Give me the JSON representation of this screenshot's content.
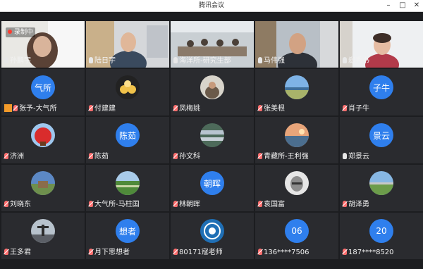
{
  "window": {
    "title": "腾讯会议"
  },
  "recording": {
    "label": "录制中"
  },
  "participants": [
    {
      "name": "孙鹏宇",
      "video": true
    },
    {
      "name": "陆日宇",
      "video": true
    },
    {
      "name": "海洋所-研究生部",
      "video": true
    },
    {
      "name": "马伟强",
      "video": true
    },
    {
      "name": "郄秀书",
      "video": true
    },
    {
      "name": "张予-大气所",
      "avatar_text": "气所",
      "host": true
    },
    {
      "name": "付建建",
      "muted": true
    },
    {
      "name": "凤梅姚",
      "muted": true
    },
    {
      "name": "张美根",
      "muted": true
    },
    {
      "name": "肖子牛",
      "avatar_text": "子牛",
      "muted": true
    },
    {
      "name": "济洲",
      "muted": true
    },
    {
      "name": "陈茹",
      "avatar_text": "陈茹",
      "muted": true
    },
    {
      "name": "孙文科",
      "muted": true
    },
    {
      "name": "青藏所-王利强",
      "muted": true
    },
    {
      "name": "郑景云",
      "avatar_text": "景云"
    },
    {
      "name": "刘晓东",
      "muted": true
    },
    {
      "name": "大气所-马柱国",
      "muted": true
    },
    {
      "name": "林朝晖",
      "avatar_text": "朝晖",
      "muted": true
    },
    {
      "name": "袁国富",
      "muted": true
    },
    {
      "name": "胡泽勇",
      "muted": true
    },
    {
      "name": "王多君",
      "muted": true
    },
    {
      "name": "月下思想者",
      "avatar_text": "想者",
      "muted": true
    },
    {
      "name": "80171寇老师",
      "muted": true
    },
    {
      "name": "136****7506",
      "avatar_text": "06",
      "muted": true
    },
    {
      "name": "187****8520",
      "avatar_text": "20",
      "muted": true
    }
  ]
}
